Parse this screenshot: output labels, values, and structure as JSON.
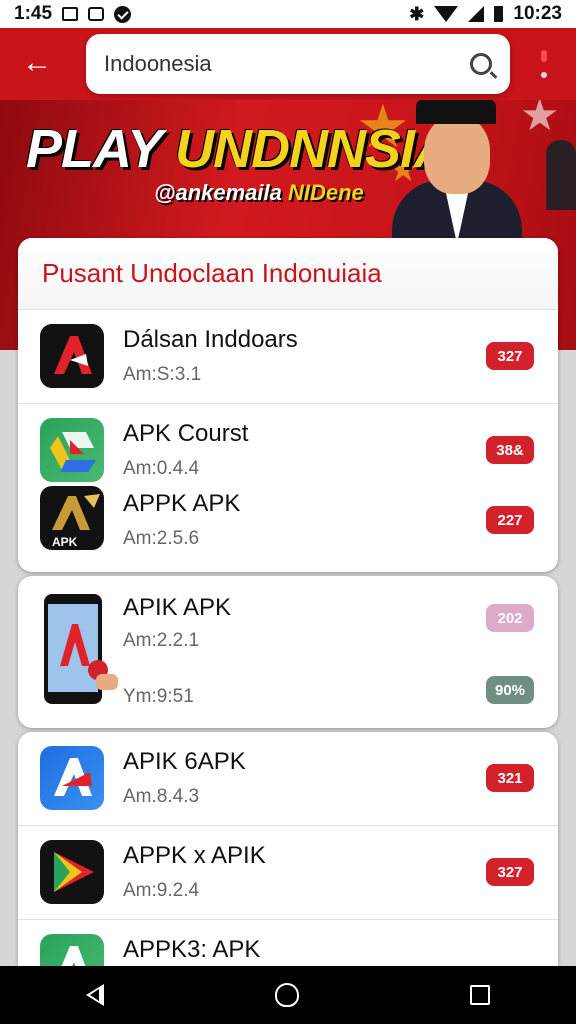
{
  "status_bar": {
    "time_left": "1:45",
    "time_right": "10:23"
  },
  "search": {
    "value": "Indoonesia"
  },
  "banner": {
    "title_white": "PLAY ",
    "title_gold": "UNDNNSIA",
    "sub_white": "@ankemaila ",
    "sub_gold": "NIDene"
  },
  "sections": [
    {
      "title": "Pusant Undoclaan Indonuiaia",
      "apps": [
        {
          "name": "Dálsan Inddoars",
          "version": "Am:S:3.1",
          "badge": "327",
          "badge_color": "#d3212b",
          "icon": "red-a-icon"
        },
        {
          "name": "APK Courst",
          "version": "Am:0.4.4",
          "badge": "38&",
          "badge_color": "#d3212b",
          "icon": "drive-icon"
        },
        {
          "name": "APPK APK",
          "version": "Am:2.5.6",
          "badge": "227",
          "badge_color": "#d3212b",
          "icon": "gold-a-icon"
        }
      ]
    },
    {
      "apps": [
        {
          "name": "APIK APK",
          "version": "Am:2.2.1",
          "badge": "202",
          "badge_color": "#dfa9c8",
          "icon": "phone-icon"
        },
        {
          "name": "",
          "version": "Ym:9:51",
          "badge": "90%",
          "badge_color": "#6f8f80",
          "icon": ""
        }
      ]
    },
    {
      "apps": [
        {
          "name": "APIK 6APK",
          "version": "Am.8.4.3",
          "badge": "321",
          "badge_color": "#d3212b",
          "icon": "blue-a-icon"
        },
        {
          "name": "APPK x APIK",
          "version": "Am:9.2.4",
          "badge": "327",
          "badge_color": "#d3212b",
          "icon": "play-icon"
        },
        {
          "name": "APPK3: APK",
          "version": "",
          "badge": "",
          "badge_color": "#d3212b",
          "icon": "green-a-icon"
        }
      ]
    }
  ]
}
